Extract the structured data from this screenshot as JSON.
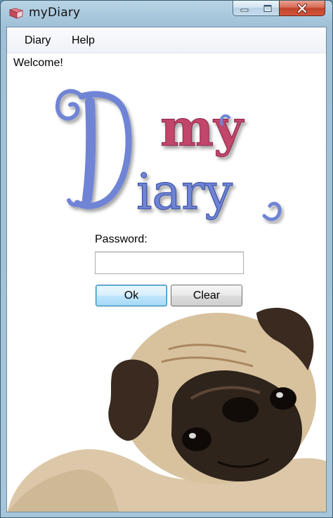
{
  "window": {
    "title": "myDiary",
    "controls": {
      "minimize": "minimize",
      "maximize": "maximize",
      "close": "close"
    }
  },
  "menu": {
    "items": [
      {
        "label": "Diary"
      },
      {
        "label": "Help"
      }
    ]
  },
  "content": {
    "welcome": "Welcome!",
    "logo": {
      "line1": "my",
      "line2": "Diary",
      "initial": "D"
    },
    "password_label": "Password:",
    "password_value": "",
    "ok_label": "Ok",
    "clear_label": "Clear"
  },
  "colors": {
    "logo_blue": "#6f84d6",
    "logo_pink": "#c2446a",
    "titlebar": "#a8c7dc",
    "close_button": "#c2432c"
  },
  "icons": {
    "app": "diary-book-icon",
    "minimize": "minimize-icon",
    "maximize": "maximize-icon",
    "close": "close-icon"
  }
}
